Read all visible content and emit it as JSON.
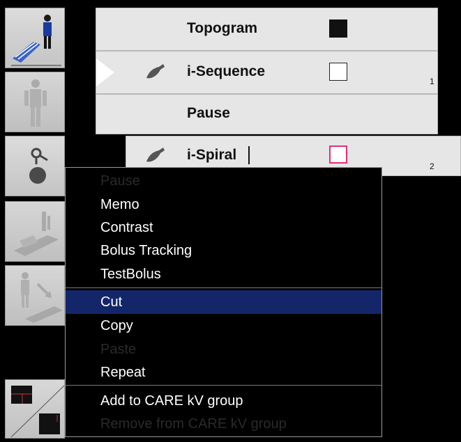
{
  "scan_list": {
    "rows": [
      {
        "label": "Topogram",
        "number": ""
      },
      {
        "label": "i-Sequence",
        "number": "1"
      },
      {
        "label": "Pause",
        "number": ""
      },
      {
        "label": "i-Spiral",
        "number": "2"
      }
    ]
  },
  "context_menu": {
    "items": [
      {
        "label": "Pause",
        "enabled": false,
        "selected": false
      },
      {
        "label": "Memo",
        "enabled": true,
        "selected": false
      },
      {
        "label": "Contrast",
        "enabled": true,
        "selected": false
      },
      {
        "label": "Bolus Tracking",
        "enabled": true,
        "selected": false
      },
      {
        "label": "TestBolus",
        "enabled": true,
        "selected": false
      },
      {
        "label": "Cut",
        "enabled": true,
        "selected": true
      },
      {
        "label": "Copy",
        "enabled": true,
        "selected": false
      },
      {
        "label": "Paste",
        "enabled": false,
        "selected": false
      },
      {
        "label": "Repeat",
        "enabled": true,
        "selected": false
      },
      {
        "label": "Add to CARE kV group",
        "enabled": true,
        "selected": false
      },
      {
        "label": "Remove from CARE kV group",
        "enabled": false,
        "selected": false
      }
    ]
  },
  "colors": {
    "menu_highlight": "#14266a",
    "row_bg": "#e6e6e6",
    "active_marker_border": "#e0307a",
    "toolbar_bg": "#d0d0d0"
  },
  "icons": {
    "toolbar": [
      "patient-on-table-icon",
      "patient-body-icon",
      "contrast-injection-icon",
      "table-position-icon",
      "patient-move-icon",
      "split-view-icon"
    ],
    "row": [
      "ct-scan-icon"
    ]
  }
}
